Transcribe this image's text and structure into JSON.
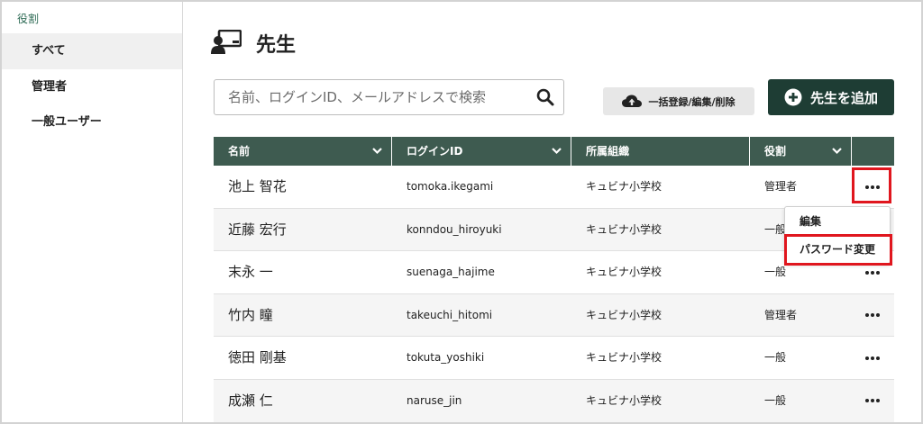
{
  "sidebar": {
    "header": "役割",
    "items": [
      {
        "label": "すべて",
        "active": true
      },
      {
        "label": "管理者",
        "active": false
      },
      {
        "label": "一般ユーザー",
        "active": false
      }
    ]
  },
  "page": {
    "title": "先生",
    "title_icon": "teacher-board-icon"
  },
  "search": {
    "placeholder": "名前、ログインID、メールアドレスで検索",
    "value": ""
  },
  "toolbar": {
    "bulk_label": "一括登録/編集/削除",
    "add_label": "先生を追加"
  },
  "table": {
    "headers": [
      {
        "label": "名前",
        "sortable": true
      },
      {
        "label": "ログインID",
        "sortable": true
      },
      {
        "label": "所属組織",
        "sortable": false
      },
      {
        "label": "役割",
        "sortable": true
      }
    ],
    "rows": [
      {
        "name": "池上 智花",
        "login": "tomoka.ikegami",
        "org": "キュビナ小学校",
        "role": "管理者"
      },
      {
        "name": "近藤 宏行",
        "login": "konndou_hiroyuki",
        "org": "キュビナ小学校",
        "role": "一般"
      },
      {
        "name": "末永 一",
        "login": "suenaga_hajime",
        "org": "キュビナ小学校",
        "role": "一般"
      },
      {
        "name": "竹内 瞳",
        "login": "takeuchi_hitomi",
        "org": "キュビナ小学校",
        "role": "管理者"
      },
      {
        "name": "徳田 剛基",
        "login": "tokuta_yoshiki",
        "org": "キュビナ小学校",
        "role": "一般"
      },
      {
        "name": "成瀬 仁",
        "login": "naruse_jin",
        "org": "キュビナ小学校",
        "role": "一般"
      }
    ]
  },
  "row_menu": {
    "items": [
      {
        "label": "編集"
      },
      {
        "label": "パスワード変更"
      }
    ]
  },
  "colors": {
    "accent_dark": "#1e3d34",
    "header_bg": "#3e5b50",
    "highlight": "#e0161e"
  }
}
